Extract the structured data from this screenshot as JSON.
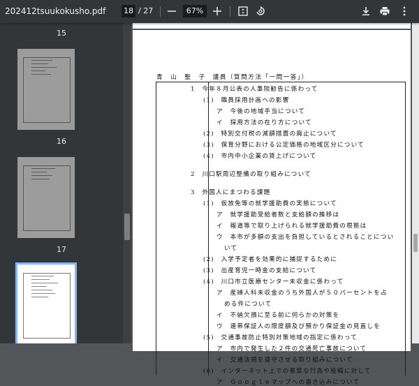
{
  "toolbar": {
    "filename": "202412tsuukokusho.pdf",
    "current_page": "18",
    "total_pages": "/ 27",
    "zoom": "67%"
  },
  "sidebar": {
    "thumbnails": [
      {
        "label": "15"
      },
      {
        "label": "16"
      },
      {
        "label": "17"
      }
    ]
  },
  "document": {
    "heading": "青　山　聖　子　議員（質問方法「一問一答」）",
    "lines": [
      "1　今年８月公表の人事院勧告に係わって",
      "(1)　職員採用計画への影響",
      "ア　今後の地域手当について",
      "イ　採用方法の在り方について",
      "(2)　特別交付税の減額措置の廃止について",
      "(3)　保育分野における公定価格の地域区分について",
      "(4)　市内中小企業の賃上げについて",
      "2　川口駅周辺整備の取り組みについて",
      "3　外国人にまつわる課題",
      "(1)　仮放免等の就学援助費の実態について",
      "ア　就学援助受給者数と支給額の推移は",
      "イ　報道等で取り上げられる就学援助費の根拠は",
      "ウ　本市が多額の支出を負担しているとされることについ",
      "いて",
      "(2)　入学予定者を効果的に捕捉するために",
      "(3)　出産育児一時金の支給について",
      "(4)　川口市立医療センター未収金に係わって",
      "ア　産婦人科未収金のうち外国人が５０パーセントを占",
      "める件について",
      "イ　不納欠損に至る前に何らかの対策を",
      "ウ　連帯保証人の限度額及び預かり保証金の見直しを",
      "(5)　交通事故防止特別対策地域の指定に係わって",
      "ア　市内で発生した２件の交通死亡事故について",
      "イ　交通法規を遵守させる取り組みについて",
      "(6)　インターネット上での悪質な行為や投稿に対して",
      "ア　Ｇｏｏｇｌｅマップへの書き込みについて"
    ]
  }
}
